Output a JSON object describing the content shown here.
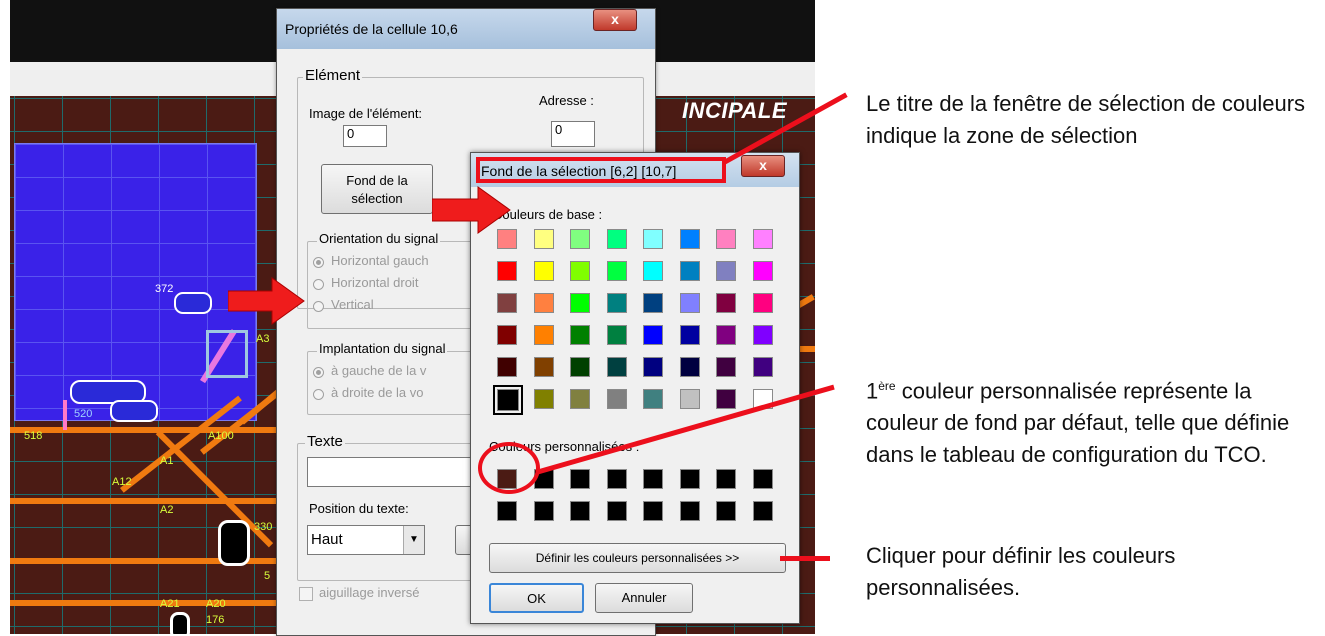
{
  "tco": {
    "title_fragment": "INCIPALE",
    "labels": {
      "n372": "372",
      "a3": "A3",
      "n520": "520",
      "n518": "518",
      "a100": "A100",
      "a1": "A1",
      "a12": "A12",
      "a2": "A2",
      "n330": "330",
      "n5": "5",
      "a21": "A21",
      "a20": "A20",
      "n176": "176"
    }
  },
  "dialog_props": {
    "title": "Propriétés de la cellule 10,6",
    "close_label": "x",
    "element_group": "Elément",
    "image_label": "Image de l'élément:",
    "image_value": "0",
    "address_label": "Adresse :",
    "address_value": "0",
    "fond_button": "Fond de la sélection",
    "orientation_group": "Orientation du signal",
    "orientation_options": [
      "Horizontal gauch",
      "Horizontal droit",
      "Vertical"
    ],
    "implantation_group": "Implantation du signal",
    "implantation_options": [
      "à gauche de la v",
      "à droite de la vo"
    ],
    "texte_group": "Texte",
    "texte_value": "",
    "position_label": "Position du texte:",
    "position_value": "Haut",
    "aiguillage_label": "aiguillage inversé"
  },
  "color_dialog": {
    "title": "Fond de la sélection [6,2] [10,7]",
    "close_label": "x",
    "base_label": "Couleurs de base :",
    "custom_label": "Couleurs personnalisées :",
    "define_button": "Définir les couleurs personnalisées >>",
    "ok_button": "OK",
    "cancel_button": "Annuler",
    "base_colors": [
      "#ff8080",
      "#ffff80",
      "#80ff80",
      "#00ff80",
      "#80ffff",
      "#0080ff",
      "#ff80c0",
      "#ff80ff",
      "#ff0000",
      "#ffff00",
      "#80ff00",
      "#00ff40",
      "#00ffff",
      "#0080c0",
      "#8080c0",
      "#ff00ff",
      "#804040",
      "#ff8040",
      "#00ff00",
      "#008080",
      "#004080",
      "#8080ff",
      "#800040",
      "#ff0080",
      "#800000",
      "#ff8000",
      "#008000",
      "#008040",
      "#0000ff",
      "#0000a0",
      "#800080",
      "#8000ff",
      "#400000",
      "#804000",
      "#004000",
      "#004040",
      "#000080",
      "#000040",
      "#400040",
      "#400080",
      "#000000",
      "#808000",
      "#808040",
      "#808080",
      "#408080",
      "#c0c0c0",
      "#400040",
      "#ffffff"
    ],
    "selected_base_index": 40,
    "custom_colors": [
      "#4b1b14",
      "#000000",
      "#000000",
      "#000000",
      "#000000",
      "#000000",
      "#000000",
      "#000000",
      "#000000",
      "#000000",
      "#000000",
      "#000000",
      "#000000",
      "#000000",
      "#000000",
      "#000000"
    ]
  },
  "annotations": {
    "title_note": "Le titre de la fenêtre de sélection de couleurs indique la zone de sélection",
    "custom_note_sup": "ère",
    "custom_note_prefix": "1",
    "custom_note": " couleur personnalisée représente la couleur de fond par défaut, telle que définie dans le tableau de configuration du TCO.",
    "define_note": "Cliquer pour définir les couleurs personnalisées."
  },
  "colors": {
    "annotation_red": "#ec0f1c",
    "arrow_red": "#ef1c1c",
    "tco_background": "#4b1b14",
    "selection_blue": "#3a22e8",
    "track_orange": "#f07a10"
  }
}
